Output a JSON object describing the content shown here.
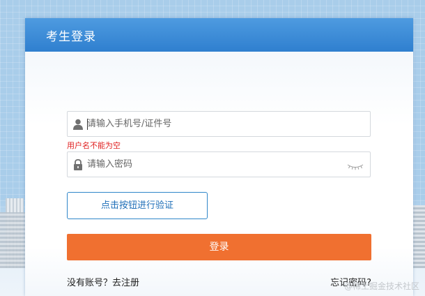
{
  "header": {
    "title": "考生登录"
  },
  "form": {
    "username": {
      "value": "",
      "placeholder": "请输入手机号/证件号",
      "icon": "user-icon"
    },
    "error_message": "用户名不能为空",
    "password": {
      "value": "",
      "placeholder": "请输入密码",
      "icon": "lock-icon",
      "toggle_icon": "eye-closed-icon"
    },
    "verify_label": "点击按钮进行验证",
    "login_label": "登录"
  },
  "links": {
    "register": "没有账号？去注册",
    "forgot": "忘记密码?"
  },
  "watermark": "@稀土掘金技术社区",
  "colors": {
    "header_blue": "#2f7fcf",
    "login_orange": "#f07030",
    "error_red": "#e02020",
    "verify_border": "#2f86c9"
  }
}
